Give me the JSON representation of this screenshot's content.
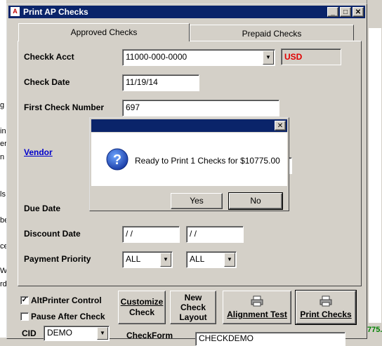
{
  "background_app": {
    "left_strip_texts": [
      "g",
      "in",
      "er",
      "n",
      "ls",
      "be",
      "ce",
      "Wo",
      "rd"
    ],
    "right_value": "775."
  },
  "window": {
    "title": "Print AP Checks",
    "minimize": "_",
    "maximize": "□",
    "close": "✕"
  },
  "tabs": [
    {
      "label": "Approved Checks"
    },
    {
      "label": "Prepaid Checks"
    }
  ],
  "form": {
    "checking_acct_label": "Checkk Acct",
    "checking_acct_value": "11000-000-0000",
    "currency": "USD",
    "check_date_label": "Check Date",
    "check_date_value": "11/19/14",
    "first_check_label": "First Check Number",
    "first_check_value": "697",
    "vendor_link": "Vendor",
    "due_date_label": "Due Date",
    "discount_date_label": "Discount Date",
    "discount_date_from": " / /",
    "discount_date_to": " / /",
    "payment_priority_label": "Payment Priority",
    "priority_from": "ALL",
    "priority_to": "ALL"
  },
  "bottom": {
    "alt_printer_label": "AltPrinter Control",
    "alt_printer_checked": true,
    "pause_label": "Pause After Check",
    "pause_checked": false,
    "cid_label": "CID",
    "cid_value": "DEMO",
    "checkform_label": "CheckForm",
    "checkform_value": "CHECKDEMO",
    "customize_line1": "Customize",
    "customize_line2": "Check",
    "new_layout_line1": "New",
    "new_layout_line2": "Check",
    "new_layout_line3": "Layout",
    "alignment_label": "Alignment Test",
    "print_label": "Print Checks"
  },
  "dialog": {
    "message": "Ready to Print 1 Checks for $10775.00",
    "yes": "Yes",
    "no": "No",
    "close": "✕",
    "icon": "question-icon"
  },
  "colors": {
    "titlebar": "#0a246a",
    "currency": "#e00000",
    "link": "#0000cc",
    "right_value": "#008000"
  }
}
